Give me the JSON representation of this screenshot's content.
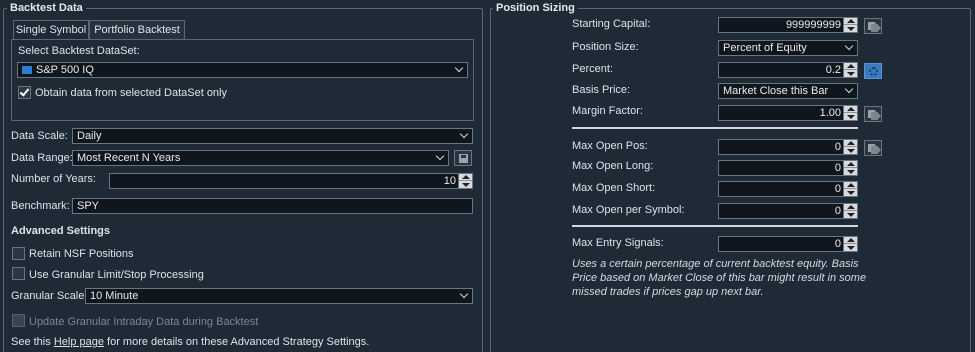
{
  "backtest": {
    "title": "Backtest Data",
    "tabs": [
      "Single Symbol",
      "Portfolio Backtest"
    ],
    "select_dataset_label": "Select Backtest DataSet:",
    "dataset_value": "S&P 500 IQ",
    "obtain_label": "Obtain data from selected DataSet only",
    "data_scale_label": "Data Scale:",
    "data_scale_value": "Daily",
    "data_range_label": "Data Range:",
    "data_range_value": "Most Recent N Years",
    "num_years_label": "Number of Years:",
    "num_years_value": "10",
    "benchmark_label": "Benchmark:",
    "benchmark_value": "SPY",
    "advanced_title": "Advanced Settings",
    "retain_nsf_label": "Retain NSF Positions",
    "granular_limit_label": "Use Granular Limit/Stop Processing",
    "granular_scale_label": "Granular Scale",
    "granular_scale_value": "10 Minute",
    "update_granular_label": "Update Granular Intraday Data during Backtest",
    "help_prefix": "See this ",
    "help_link": "Help page",
    "help_suffix": " for more details on these Advanced Strategy Settings."
  },
  "position": {
    "title": "Position Sizing",
    "starting_capital_label": "Starting Capital:",
    "starting_capital_value": "999999999",
    "position_size_label": "Position Size:",
    "position_size_value": "Percent of Equity",
    "percent_label": "Percent:",
    "percent_value": "0.2",
    "basis_price_label": "Basis Price:",
    "basis_price_value": "Market Close this Bar",
    "margin_factor_label": "Margin Factor:",
    "margin_factor_value": "1.00",
    "max_open_pos_label": "Max Open Pos:",
    "max_open_pos_value": "0",
    "max_open_long_label": "Max Open Long:",
    "max_open_long_value": "0",
    "max_open_short_label": "Max Open Short:",
    "max_open_short_value": "0",
    "max_open_per_symbol_label": "Max Open per Symbol:",
    "max_open_per_symbol_value": "0",
    "max_entry_signals_label": "Max Entry Signals:",
    "max_entry_signals_value": "0",
    "note_line1": "Uses a certain percentage of current backtest equity. Basis",
    "note_line2": "Price based on Market Close of this bar might result in some",
    "note_line3": "missed trades if prices gap up next bar."
  },
  "colors": {
    "background": "#1e2a35",
    "input_bg": "#0f161d",
    "accent_blue": "#3b79c0"
  },
  "icons": [
    "sp500-icon",
    "save-icon",
    "tag-icon",
    "gear-icon",
    "chevron-down-icon",
    "spinner-icon",
    "checkmark-icon"
  ]
}
